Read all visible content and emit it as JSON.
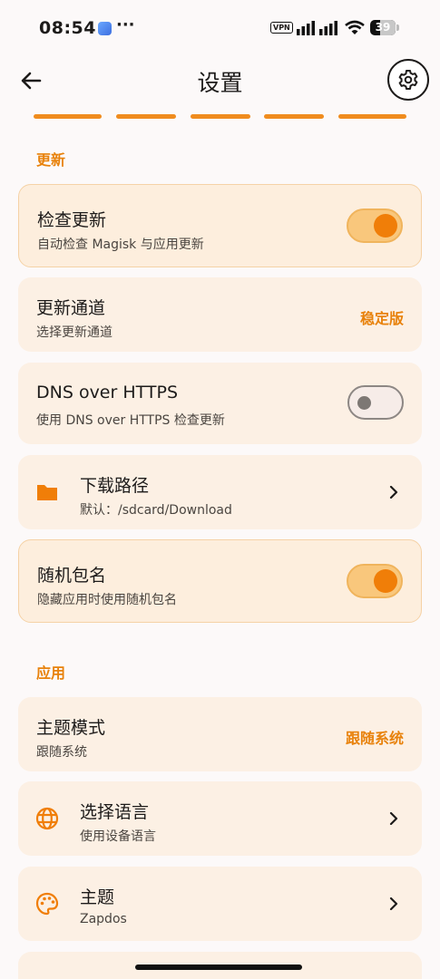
{
  "status_bar": {
    "time": "08:54",
    "dots": "···",
    "vpn": "VPN",
    "battery": "39",
    "battery_level": 0.39
  },
  "header": {
    "title": "设置",
    "back_icon": "arrow-left-icon",
    "settings_icon": "gear-icon"
  },
  "sections": {
    "update": "更新",
    "app": "应用"
  },
  "items": {
    "check_update": {
      "title": "检查更新",
      "sub": "自动检查 Magisk 与应用更新",
      "toggle": true
    },
    "update_channel": {
      "title": "更新通道",
      "sub": "选择更新通道",
      "value": "稳定版"
    },
    "dns": {
      "title": "DNS over HTTPS",
      "sub": "使用 DNS over HTTPS 检查更新",
      "toggle": false
    },
    "download_path": {
      "title": "下载路径",
      "sub": "默认：/sdcard/Download",
      "icon": "folder-icon"
    },
    "random_pkg": {
      "title": "随机包名",
      "sub": "隐藏应用时使用随机包名",
      "toggle": true
    },
    "theme_mode": {
      "title": "主题模式",
      "sub": "跟随系统",
      "value": "跟随系统"
    },
    "language": {
      "title": "选择语言",
      "sub": "使用设备语言",
      "icon": "globe-icon"
    },
    "theme": {
      "title": "主题",
      "sub": "Zapdos",
      "icon": "palette-icon"
    }
  },
  "colors": {
    "accent": "#e8820c",
    "card": "#fcf0e4",
    "background": "#fcf9f9"
  }
}
